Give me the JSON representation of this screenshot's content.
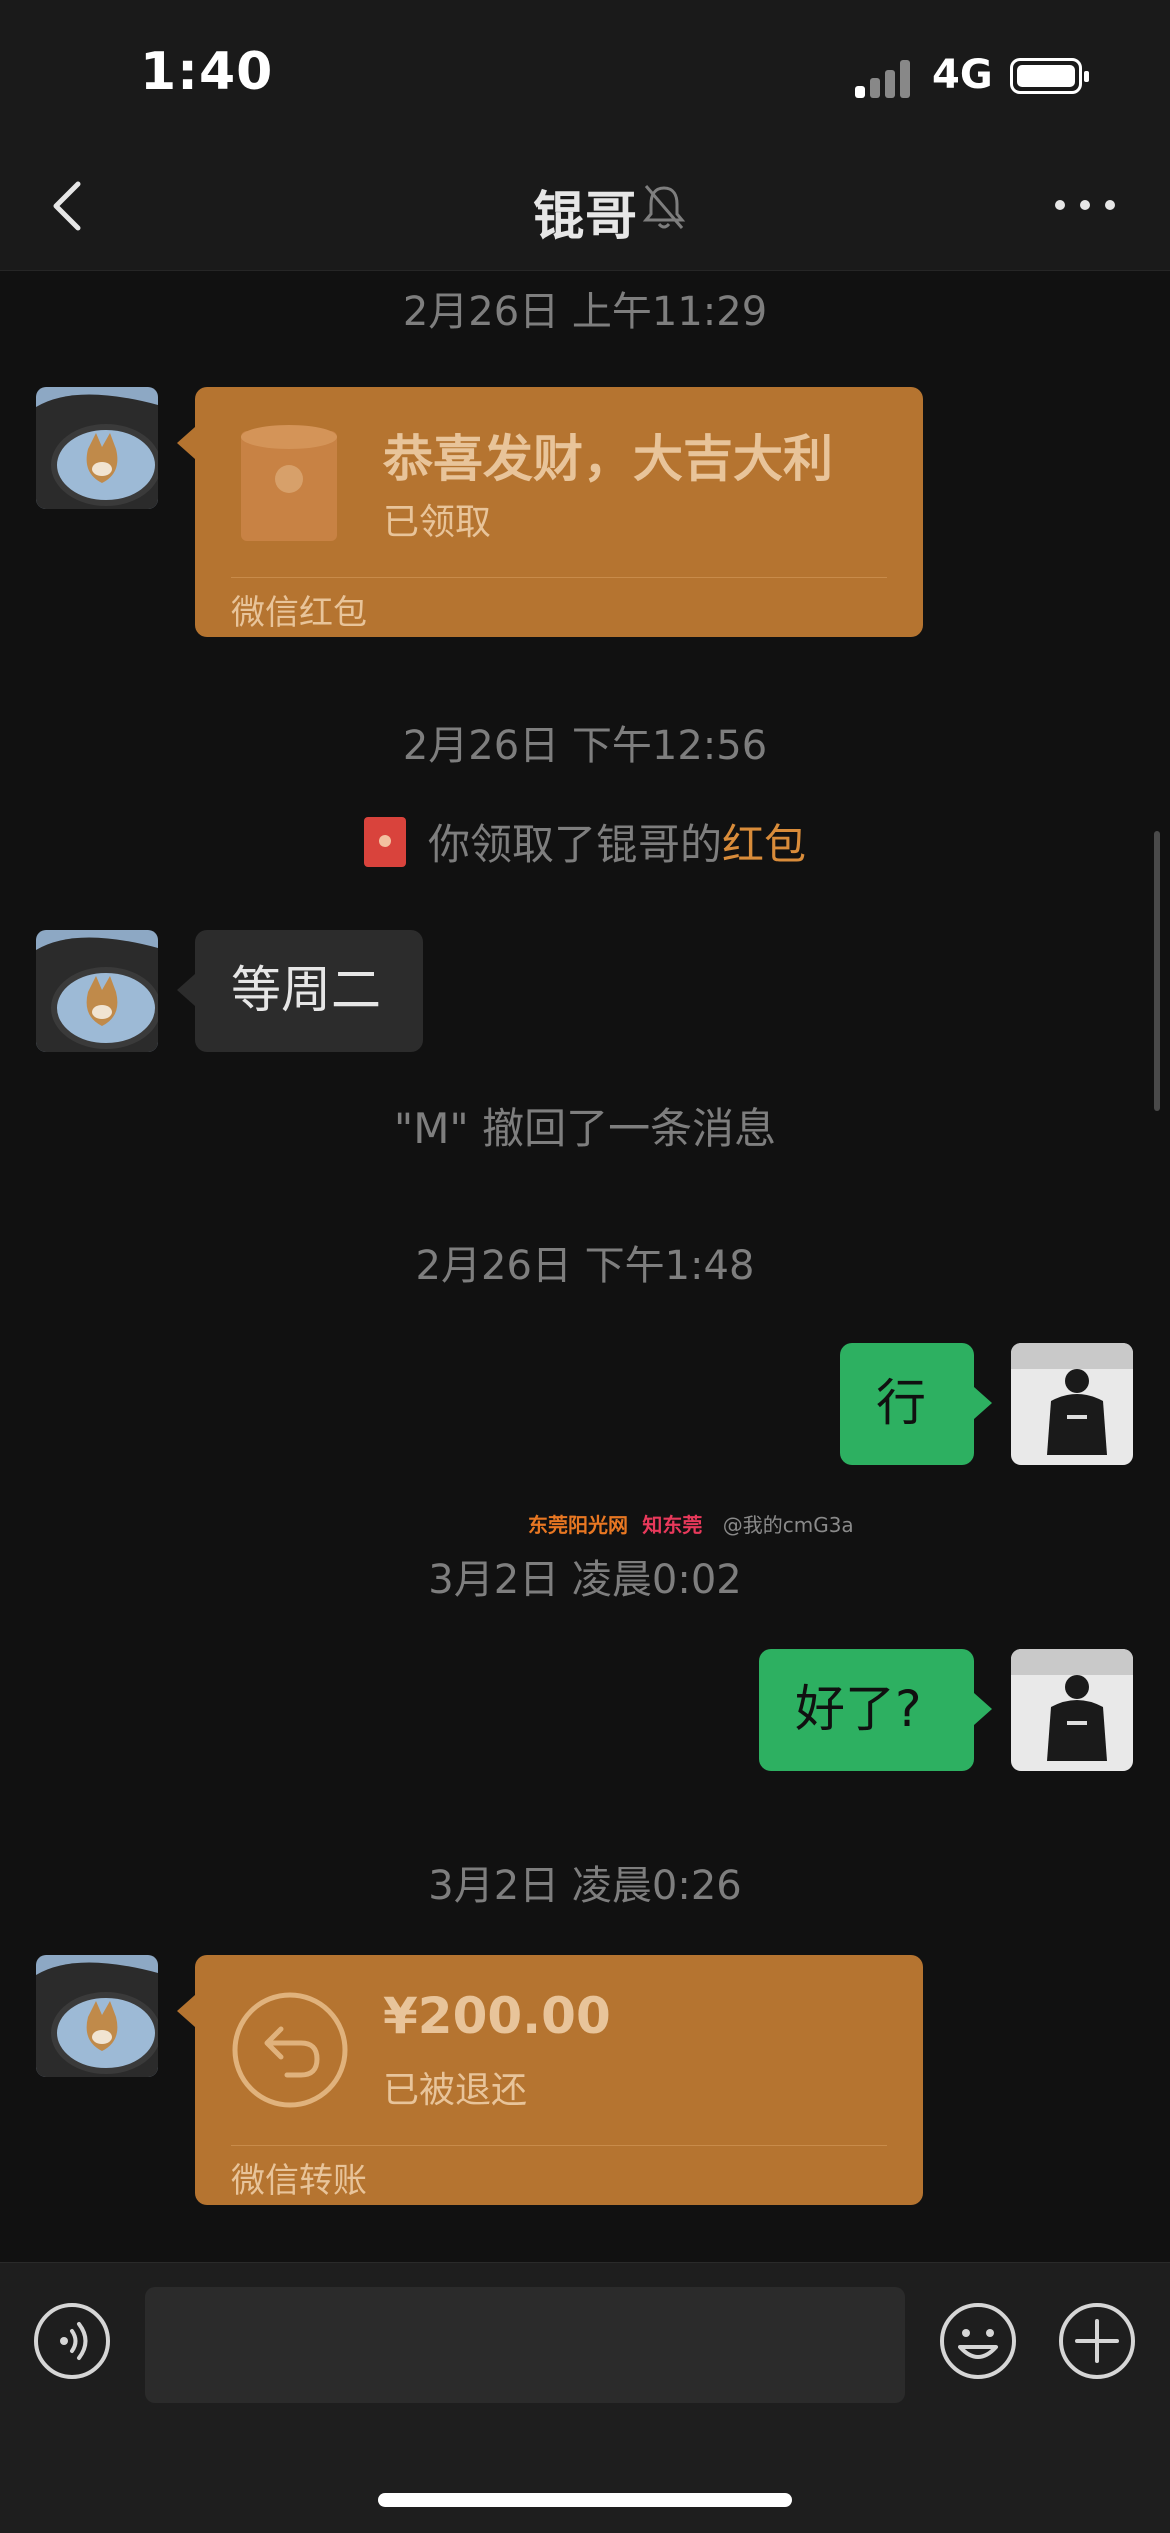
{
  "status_bar": {
    "time": "1:40",
    "network": "4G"
  },
  "nav": {
    "title": "锟哥"
  },
  "messages": {
    "ts1": "2月26日 上午11:29",
    "redpacket": {
      "title": "恭喜发财，大吉大利",
      "status": "已领取",
      "footer": "微信红包"
    },
    "ts2": "2月26日 下午12:56",
    "received_notice": {
      "text": "你领取了锟哥的",
      "link": "红包"
    },
    "msg1": "等周二",
    "recall_notice": "\"M\" 撤回了一条消息",
    "ts3": "2月26日 下午1:48",
    "msg2": "行",
    "ts4": "3月2日 凌晨0:02",
    "msg3": "好了?",
    "ts5": "3月2日 凌晨0:26",
    "transfer": {
      "amount": "¥200.00",
      "status": "已被退还",
      "footer": "微信转账"
    }
  },
  "watermark": {
    "site1": "东莞阳光网",
    "site2": "知东莞",
    "handle": "@我的cmG3a"
  },
  "colors": {
    "accent_green": "#2db061",
    "card_orange": "#b57430",
    "hongbao_text": "#d98c3a",
    "background": "#111111"
  },
  "icons": [
    "back-chevron-icon",
    "mute-bell-icon",
    "more-dots-icon",
    "voice-icon",
    "emoji-icon",
    "plus-icon",
    "refund-icon",
    "red-packet-icon"
  ]
}
